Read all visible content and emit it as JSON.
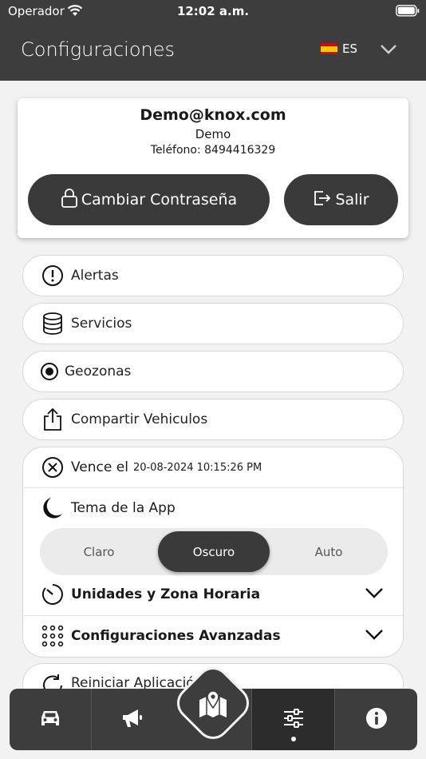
{
  "status_bar": {
    "carrier": "Operador",
    "time": "12:02 a.m."
  },
  "header": {
    "title": "Configuraciones",
    "language_code": "ES",
    "language_flag": "spain-flag-icon"
  },
  "account": {
    "email": "Demo@knox.com",
    "name": "Demo",
    "phone": "Teléfono: 8494416329",
    "change_password_label": "Cambiar Contraseña",
    "logout_label": "Salir"
  },
  "menu": {
    "alerts": "Alertas",
    "services": "Servicios",
    "geozones": "Geozonas",
    "share_vehicles": "Compartir Vehiculos"
  },
  "panel": {
    "expires_label": "Vence el",
    "expires_date": "20-08-2024 10:15:26 PM",
    "theme_label": "Tema de la App",
    "theme_options": [
      "Claro",
      "Oscuro",
      "Auto"
    ],
    "theme_selected": "Oscuro",
    "units_label": "Unidades y Zona Horaria",
    "advanced_label": "Configuraciones Avanzadas"
  },
  "restart_label": "Reiniciar Aplicación",
  "tabs": [
    "car-icon",
    "megaphone-icon",
    "map-icon",
    "sliders-icon",
    "info-icon"
  ],
  "active_tab": "sliders-icon",
  "colors": {
    "header_bg": "#3d3d3d",
    "button_dark": "#3a3a3a",
    "page_bg": "#f2f2f2"
  }
}
